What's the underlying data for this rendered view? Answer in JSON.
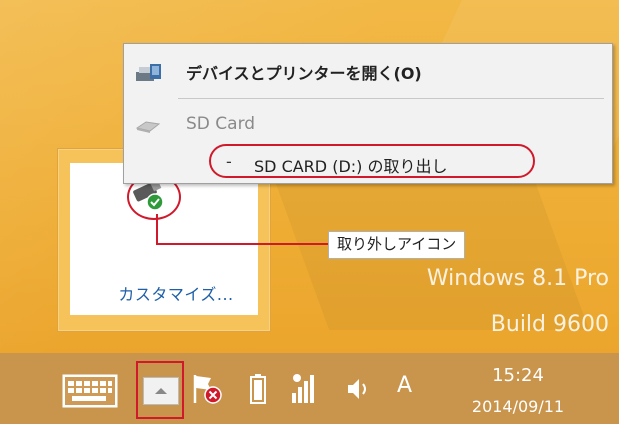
{
  "context_menu": {
    "open_devices_label": "デバイスとプリンターを開く(O)",
    "device_label": "SD Card",
    "eject_prefix": "-",
    "eject_label": "SD CARD (D:) の取り出し"
  },
  "overflow_panel": {
    "customize_label": "カスタマイズ..."
  },
  "callout": {
    "label": "取り外しアイコン"
  },
  "watermark": {
    "line1": "Windows 8.1 Pro",
    "line2": "Build 9600"
  },
  "taskbar": {
    "ime_mode": "A",
    "time": "15:24",
    "date": "2014/09/11"
  },
  "icons": {
    "devices": "printer-icon",
    "sd_card": "drive-icon",
    "safely_remove": "usb-eject-icon",
    "keyboard": "touch-keyboard-icon",
    "show_hidden": "chevron-up-icon",
    "action_center": "flag-icon",
    "battery": "battery-icon",
    "network": "signal-icon",
    "volume": "speaker-icon"
  },
  "colors": {
    "highlight": "#d0192b",
    "link": "#1f5fa8",
    "taskbar": "#c9944c",
    "desktop": "#f0b43c"
  }
}
